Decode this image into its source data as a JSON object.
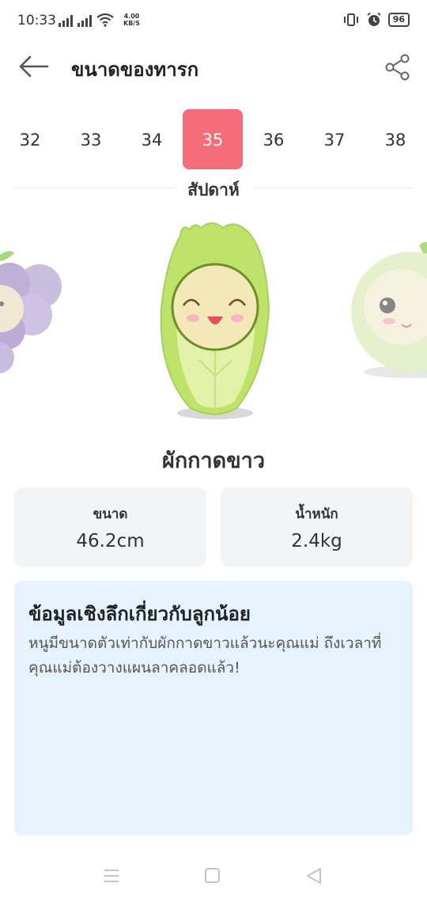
{
  "status_bar": {
    "time": "10:33",
    "net_speed_value": "4.00",
    "net_speed_unit": "KB/S",
    "battery": "96"
  },
  "header": {
    "title": "ขนาดของทารก"
  },
  "weeks": {
    "items": [
      "32",
      "33",
      "34",
      "35",
      "36",
      "37",
      "38"
    ],
    "selected": "35",
    "label": "สัปดาห์"
  },
  "produce": {
    "name": "ผักกาดขาว"
  },
  "stats": {
    "size_label": "ขนาด",
    "size_value": "46.2cm",
    "weight_label": "น้ำหนัก",
    "weight_value": "2.4kg"
  },
  "insight": {
    "title": "ข้อมูลเชิงลึกเกี่ยวกับลูกน้อย",
    "text": "หนูมีขนาดตัวเท่ากับผักกาดขาวแล้วนะคุณแม่ ถึงเวลาที่คุณแม่ต้องวางแผนลาคลอดแล้ว!"
  },
  "colors": {
    "accent": "#f26c79",
    "card_bg": "#f3f4f6",
    "insight_bg": "#e6f2fd"
  }
}
